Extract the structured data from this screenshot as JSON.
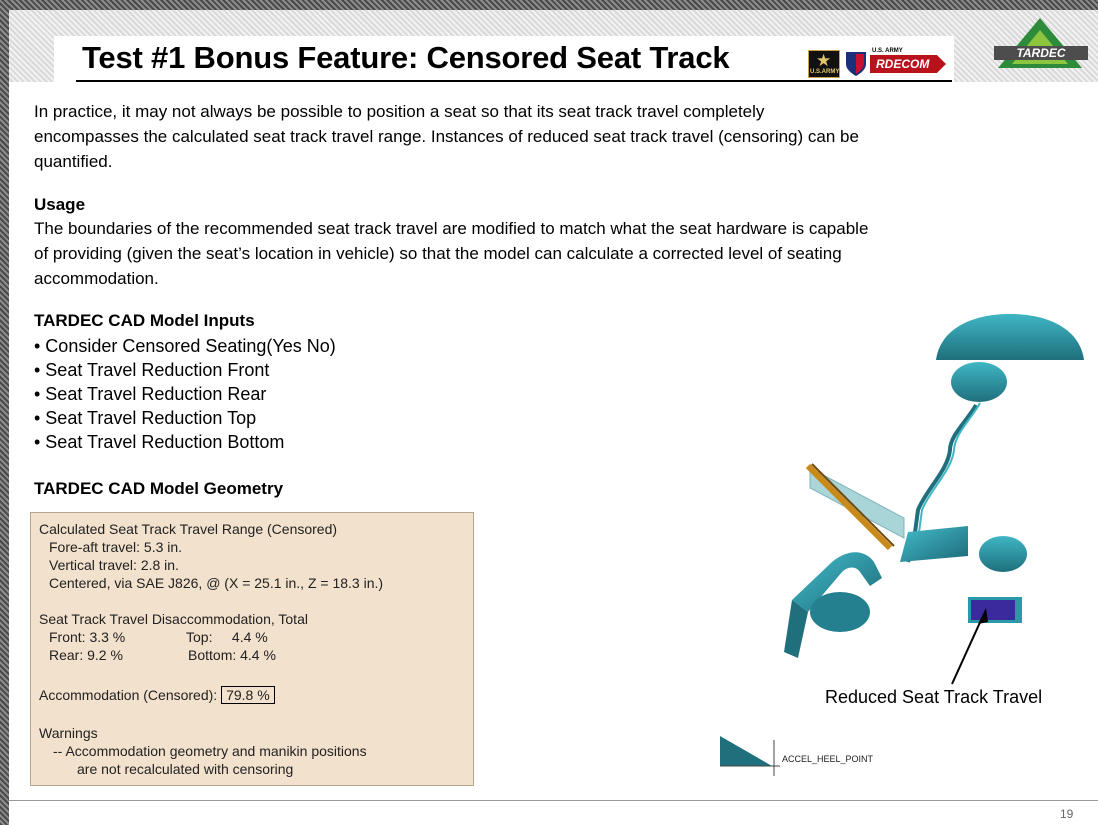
{
  "slide": {
    "title": "Test #1 Bonus Feature: Censored Seat Track",
    "page_number": "19"
  },
  "logos": {
    "army_text": "U.S.ARMY",
    "rdecom_small": "U.S. ARMY",
    "rdecom_text": "RDECOM",
    "tardec_text": "TARDEC"
  },
  "intro": {
    "line1": "In practice, it may not always be possible to position a seat so that its seat track travel completely",
    "line2": "encompasses the calculated seat track travel range. Instances of reduced seat track travel (censoring) can be",
    "line3": "quantified."
  },
  "usage": {
    "heading": "Usage",
    "line1": "The boundaries of the recommended seat track travel are modified to match what the seat hardware is capable",
    "line2": "of providing (given the seat’s location in vehicle) so that the model can calculate a corrected level of seating",
    "line3": "accommodation."
  },
  "inputs": {
    "heading": "TARDEC CAD Model Inputs",
    "items": [
      "• Consider Censored Seating(Yes No)",
      "• Seat Travel Reduction Front",
      "• Seat Travel Reduction Rear",
      "• Seat Travel Reduction Top",
      "• Seat Travel Reduction Bottom"
    ]
  },
  "geometry": {
    "heading": "TARDEC CAD Model Geometry"
  },
  "results": {
    "range_heading": "Calculated Seat Track Travel Range (Censored)",
    "fore_aft": "Fore-aft travel: 5.3 in.",
    "vertical": "Vertical travel: 2.8 in.",
    "centered": "Centered, via SAE J826, @ (X = 25.1 in., Z = 18.3 in.)",
    "disacc_heading": "Seat Track Travel Disaccommodation, Total",
    "front": "Front: 3.3 %",
    "top": "Top:     4.4 %",
    "rear": "Rear: 9.2 %",
    "bottom": "Bottom: 4.4 %",
    "acc_label": "Accommodation (Censored):",
    "acc_value": "79.8 %",
    "warnings_heading": "Warnings",
    "warning_line1": "-- Accommodation geometry and manikin positions",
    "warning_line2": "are not recalculated with censoring"
  },
  "figure": {
    "callout": "Reduced Seat Track Travel",
    "reference_label": "ACCEL_HEEL_POINT",
    "colors": {
      "body": "#2b9aa8",
      "body_dark": "#1f6f7c",
      "reduced_travel": "#3b2a9e",
      "rail": "#c98a1a"
    }
  }
}
